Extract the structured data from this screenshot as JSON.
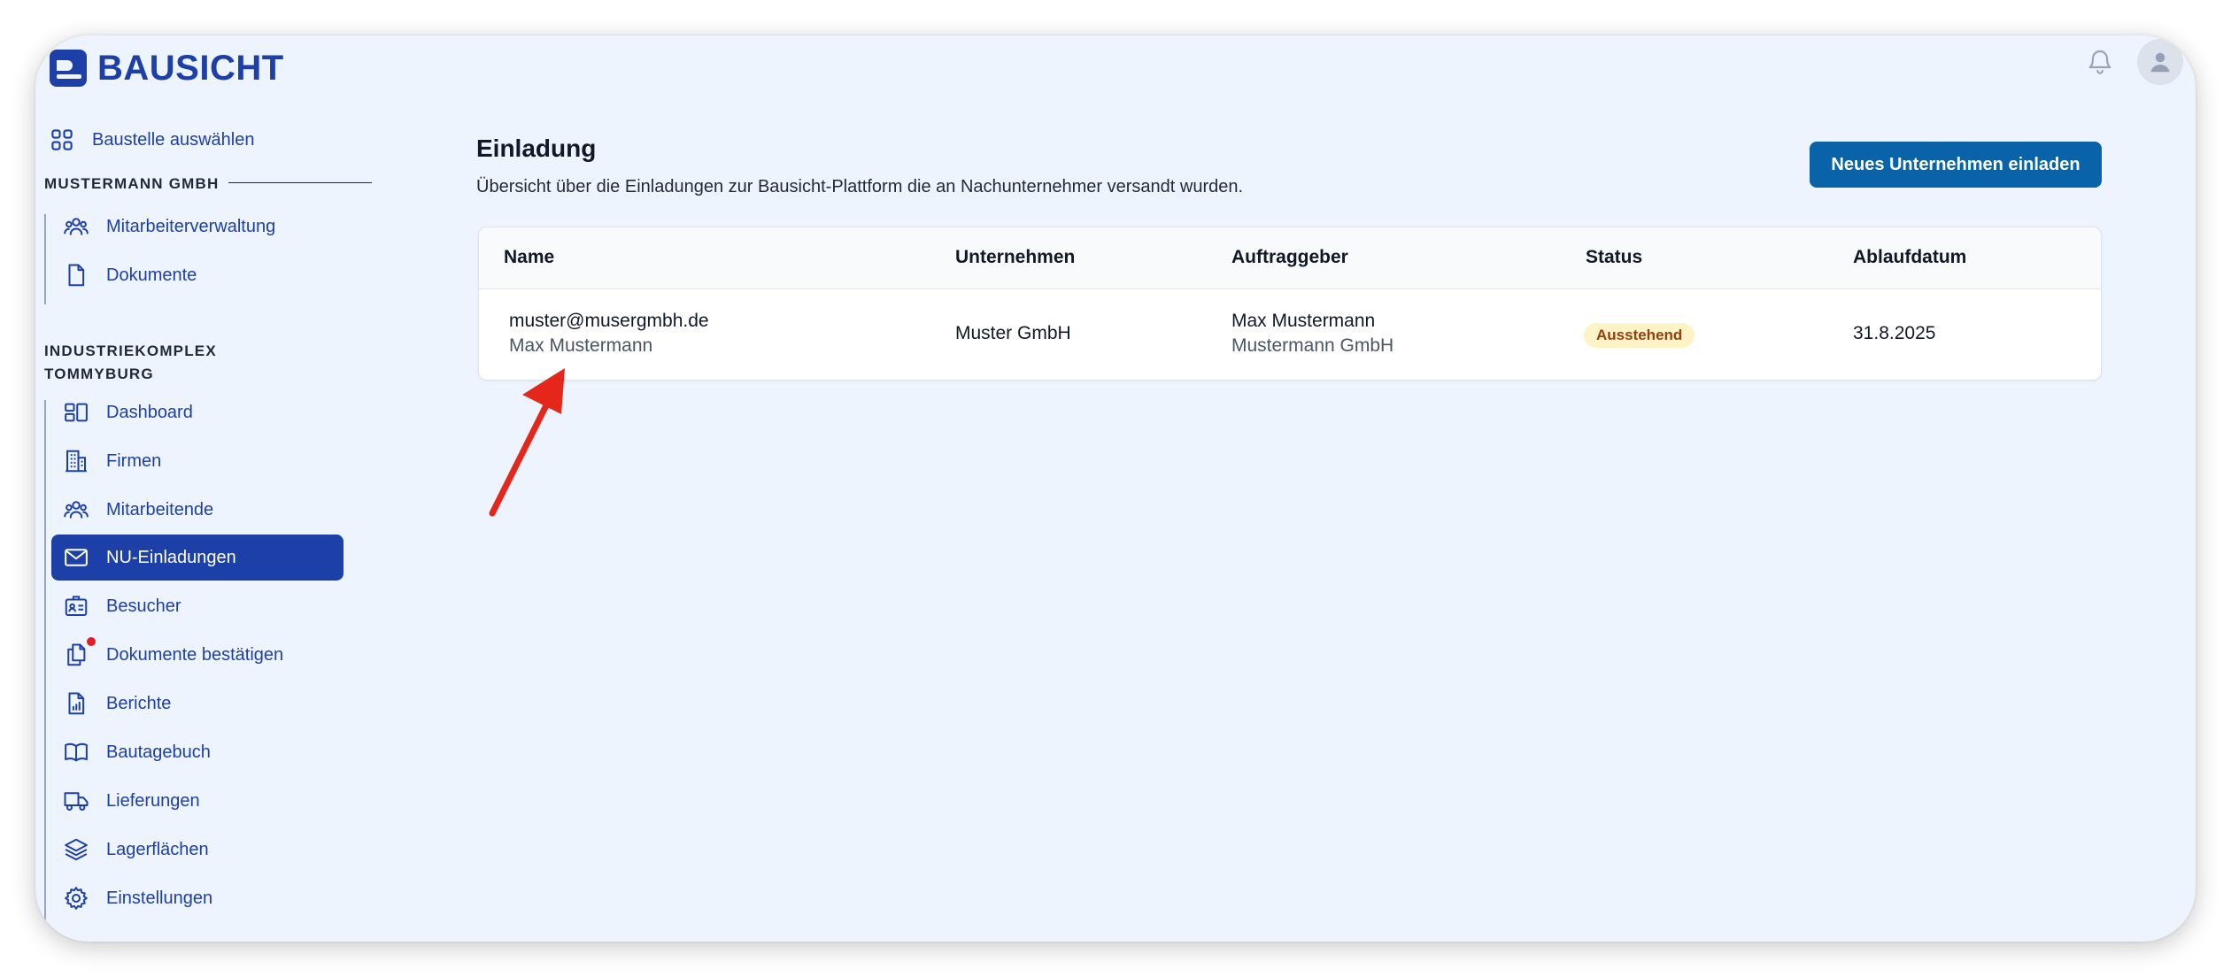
{
  "app": {
    "name": "BAUSICHT"
  },
  "sidebar": {
    "select_site": "Baustelle auswählen",
    "company_section": "MUSTERMANN GMBH",
    "company_items": [
      "Mitarbeiterverwaltung",
      "Dokumente"
    ],
    "project_section_line1": "INDUSTRIEKOMPLEX",
    "project_section_line2": "TOMMYBURG",
    "project_items": [
      "Dashboard",
      "Firmen",
      "Mitarbeitende",
      "NU-Einladungen",
      "Besucher",
      "Dokumente bestätigen",
      "Berichte",
      "Bautagebuch",
      "Lieferungen",
      "Lagerflächen",
      "Einstellungen"
    ],
    "active_item": "NU-Einladungen"
  },
  "main": {
    "title": "Einladung",
    "subtitle": "Übersicht über die Einladungen zur Bausicht-Plattform die an Nachunternehmer versandt wurden.",
    "invite_button": "Neues Unternehmen einladen",
    "table": {
      "columns": [
        "Name",
        "Unternehmen",
        "Auftraggeber",
        "Status",
        "Ablaufdatum"
      ],
      "rows": [
        {
          "email": "muster@musergmbh.de",
          "name": "Max Mustermann",
          "company": "Muster GmbH",
          "client_name": "Max Mustermann",
          "client_company": "Mustermann GmbH",
          "status": "Ausstehend",
          "expiry": "31.8.2025"
        }
      ]
    }
  },
  "colors": {
    "brand": "#1d3fa8",
    "button": "#0a62a8",
    "background": "#eef4fd",
    "status_bg": "#fef3c7",
    "arrow": "#e5261a",
    "notification_dot": "#e11d2a"
  }
}
